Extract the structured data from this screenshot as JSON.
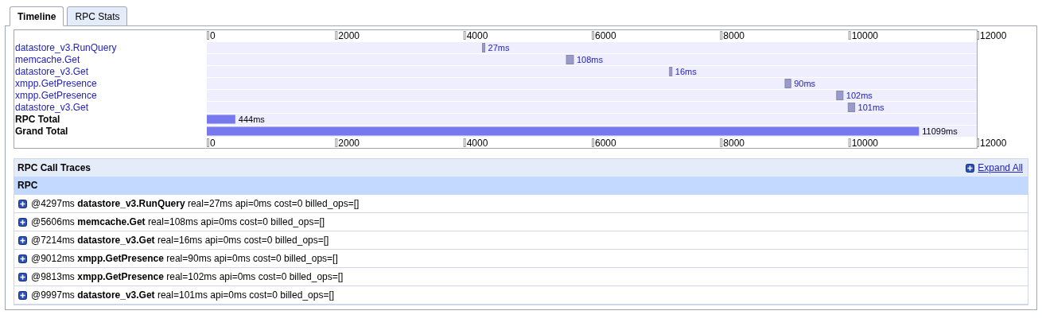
{
  "tabs": [
    {
      "label": "Timeline",
      "selected": true
    },
    {
      "label": "RPC Stats",
      "selected": false
    }
  ],
  "timeline": {
    "top_axis": [
      "0",
      "2000",
      "4000",
      "6000",
      "8000",
      "10000",
      "12000"
    ],
    "rows": [
      {
        "label": "datastore_v3.RunQuery",
        "kind": "rpc",
        "start": {
          "level": 0.358
        },
        "level": 0.3604,
        "duration": "27ms"
      },
      {
        "label": "memcache.Get",
        "kind": "rpc",
        "start": {
          "level": 0.467
        },
        "level": 0.4762,
        "duration": "108ms"
      },
      {
        "label": "datastore_v3.Get",
        "kind": "rpc",
        "start": {
          "level": 0.601
        },
        "level": 0.6025,
        "duration": "16ms"
      },
      {
        "label": "xmpp.GetPresence",
        "kind": "rpc",
        "start": {
          "level": 0.751
        },
        "level": 0.7585,
        "duration": "90ms"
      },
      {
        "label": "xmpp.GetPresence",
        "kind": "rpc",
        "start": {
          "level": 0.818
        },
        "level": 0.8263,
        "duration": "102ms"
      },
      {
        "label": "datastore_v3.Get",
        "kind": "rpc",
        "start": {
          "level": 0.833
        },
        "level": 0.8415,
        "duration": "101ms"
      },
      {
        "label": "RPC Total",
        "kind": "total",
        "level": 0.037,
        "duration": "444ms"
      },
      {
        "label": "Grand Total",
        "kind": "total",
        "level": 0.9249,
        "duration": "11099ms"
      }
    ],
    "bottom_axis": [
      "0",
      "2000",
      "4000",
      "6000",
      "8000",
      "10000",
      "12000"
    ]
  },
  "traces": {
    "title": "RPC Call Traces",
    "expand_all": "Expand All",
    "column": "RPC",
    "rows": [
      "@4297ms **datastore_v3.RunQuery** real=27ms api=0ms cost=0 billed_ops=[]",
      "@5606ms **memcache.Get** real=108ms api=0ms cost=0 billed_ops=[]",
      "@7214ms **datastore_v3.Get** real=16ms api=0ms cost=0 billed_ops=[]",
      "@9012ms **xmpp.GetPresence** real=90ms api=0ms cost=0 billed_ops=[]",
      "@9813ms **xmpp.GetPresence** real=102ms api=0ms cost=0 billed_ops=[]",
      "@9997ms **datastore_v3.Get** real=101ms api=0ms cost=0 billed_ops=[]"
    ]
  }
}
